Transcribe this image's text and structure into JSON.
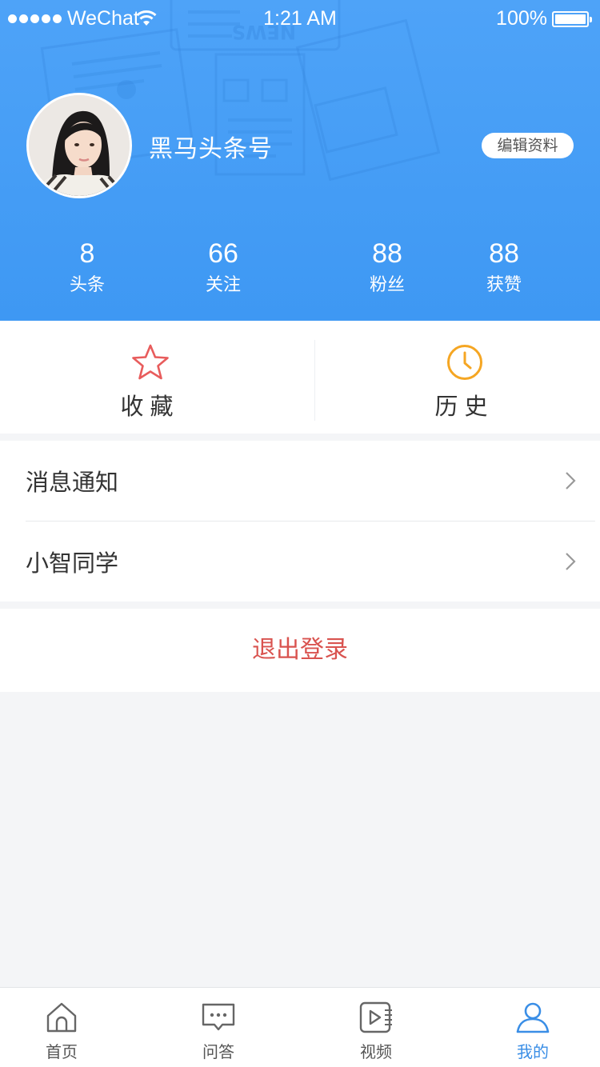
{
  "status_bar": {
    "carrier": "WeChat",
    "time": "1:21 AM",
    "battery": "100%"
  },
  "profile": {
    "username": "黑马头条号",
    "edit_label": "编辑资料"
  },
  "stats": [
    {
      "value": "8",
      "label": "头条"
    },
    {
      "value": "66",
      "label": "关注"
    },
    {
      "value": "88",
      "label": "粉丝"
    },
    {
      "value": "88",
      "label": "获赞"
    }
  ],
  "quick_actions": {
    "favorites_label": "收藏",
    "history_label": "历史"
  },
  "menu": [
    {
      "label": "消息通知"
    },
    {
      "label": "小智同学"
    }
  ],
  "logout_label": "退出登录",
  "tabbar": [
    {
      "label": "首页",
      "icon": "home-icon"
    },
    {
      "label": "问答",
      "icon": "chat-bubble-icon"
    },
    {
      "label": "视频",
      "icon": "video-play-icon"
    },
    {
      "label": "我的",
      "icon": "user-icon",
      "active": true
    }
  ],
  "colors": {
    "header": "#4ea3f8",
    "accent": "#3a8ee6",
    "favorite_star": "#e85c5c",
    "history_clock": "#f5a623",
    "logout": "#d9534f"
  }
}
